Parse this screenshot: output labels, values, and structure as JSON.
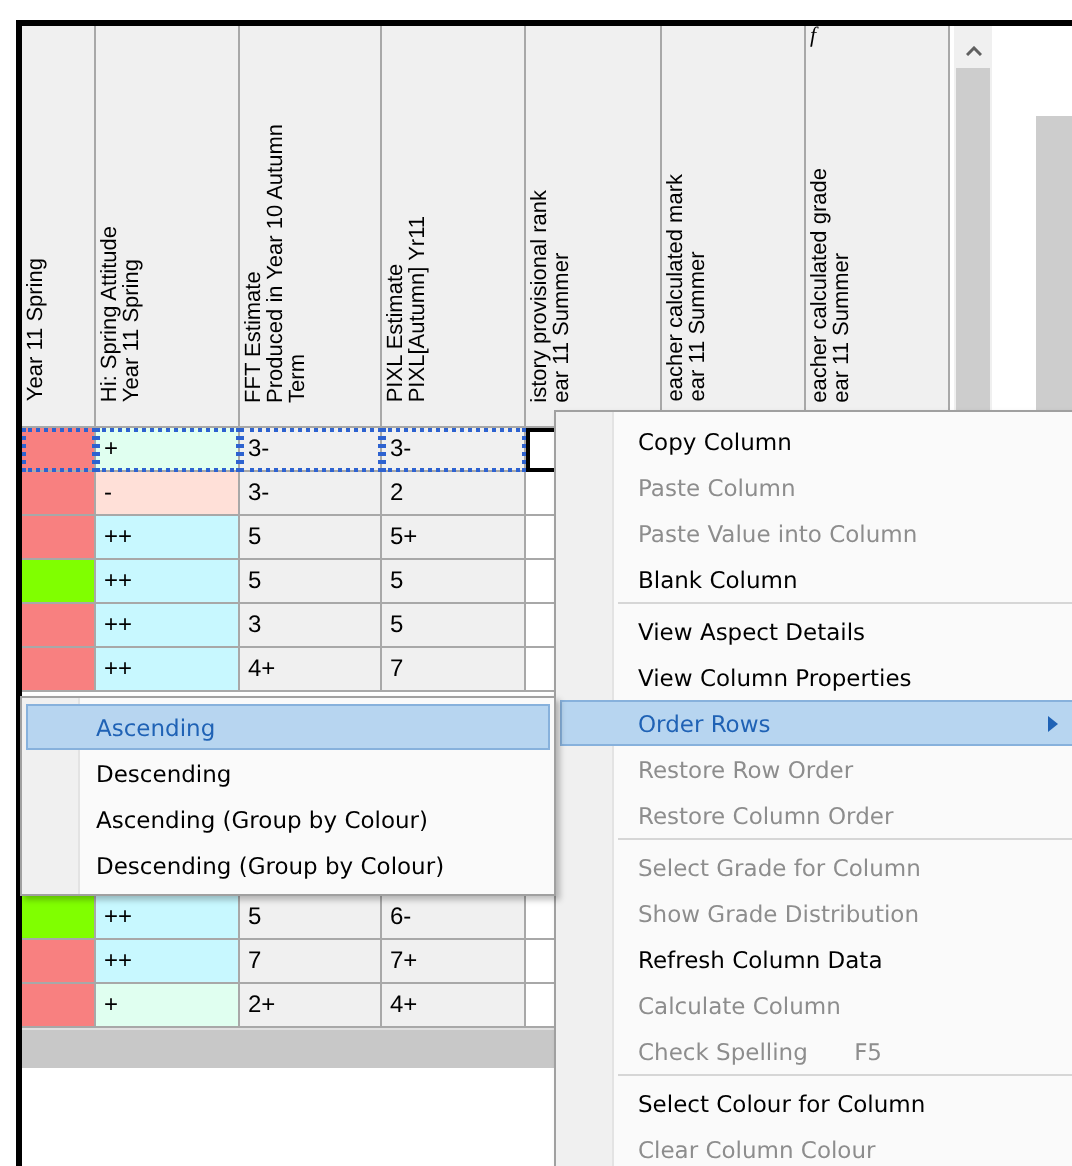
{
  "table": {
    "columns": [
      {
        "lines": [
          "Year 11 Spring"
        ]
      },
      {
        "lines": [
          "Hi: Spring Attitude",
          "Year 11 Spring"
        ]
      },
      {
        "lines": [
          "FFT Estimate",
          "Produced in Year 10 Autumn",
          "Term"
        ]
      },
      {
        "lines": [
          "PIXL Estimate",
          "PIXL[Autumn] Yr11"
        ]
      },
      {
        "lines": [
          "istory provisional rank",
          "ear 11 Summer"
        ]
      },
      {
        "lines": [
          "eacher calculated mark",
          "ear 11 Summer"
        ]
      },
      {
        "lines": [
          "eacher calculated grade",
          "ear 11 Summer"
        ],
        "formula_mark": "f"
      }
    ],
    "rows_above_menu": [
      {
        "selected": true,
        "band": {
          "color": "#f88080"
        },
        "attitude": {
          "text": "+",
          "color": "#e0fff0"
        },
        "fft": "3-",
        "pixl": "3-"
      },
      {
        "selected": false,
        "band": {
          "color": "#f88080"
        },
        "attitude": {
          "text": "-",
          "color": "#ffe0d8"
        },
        "fft": "3-",
        "pixl": "2"
      },
      {
        "selected": false,
        "band": {
          "color": "#f88080"
        },
        "attitude": {
          "text": "++",
          "color": "#c8f8ff"
        },
        "fft": "5",
        "pixl": "5+"
      },
      {
        "selected": false,
        "band": {
          "color": "#80ff00"
        },
        "attitude": {
          "text": "++",
          "color": "#c8f8ff"
        },
        "fft": "5",
        "pixl": "5"
      },
      {
        "selected": false,
        "band": {
          "color": "#f88080"
        },
        "attitude": {
          "text": "++",
          "color": "#c8f8ff"
        },
        "fft": "3",
        "pixl": "5"
      },
      {
        "selected": false,
        "band": {
          "color": "#f88080"
        },
        "attitude": {
          "text": "++",
          "color": "#c8f8ff"
        },
        "fft": "4+",
        "pixl": "7"
      }
    ],
    "rows_below_menu": [
      {
        "selected": false,
        "band": {
          "color": "#80ff00"
        },
        "attitude": {
          "text": "++",
          "color": "#c8f8ff"
        },
        "fft": "5",
        "pixl": "6-"
      },
      {
        "selected": false,
        "band": {
          "color": "#f88080"
        },
        "attitude": {
          "text": "++",
          "color": "#c8f8ff"
        },
        "fft": "7",
        "pixl": "7+"
      },
      {
        "selected": false,
        "band": {
          "color": "#f88080"
        },
        "attitude": {
          "text": "+",
          "color": "#e0fff0"
        },
        "fft": "2+",
        "pixl": "4+"
      }
    ]
  },
  "context_menu": {
    "items": [
      {
        "label": "Copy Column",
        "kind": "command",
        "disabled": false,
        "selected": false,
        "separator_after": false
      },
      {
        "label": "Paste Column",
        "kind": "command",
        "disabled": true,
        "selected": false,
        "separator_after": false
      },
      {
        "label": "Paste Value into Column",
        "kind": "command",
        "disabled": true,
        "selected": false,
        "separator_after": false
      },
      {
        "label": "Blank Column",
        "kind": "command",
        "disabled": false,
        "selected": false,
        "separator_after": true
      },
      {
        "label": "View Aspect Details",
        "kind": "command",
        "disabled": false,
        "selected": false,
        "separator_after": false
      },
      {
        "label": "View Column Properties",
        "kind": "command",
        "disabled": false,
        "selected": false,
        "separator_after": false
      },
      {
        "label": "Order Rows",
        "kind": "submenu",
        "disabled": false,
        "selected": true,
        "separator_after": false
      },
      {
        "label": "Restore Row Order",
        "kind": "command",
        "disabled": true,
        "selected": false,
        "separator_after": false
      },
      {
        "label": "Restore Column Order",
        "kind": "command",
        "disabled": true,
        "selected": false,
        "separator_after": true
      },
      {
        "label": "Select Grade for Column",
        "kind": "command",
        "disabled": true,
        "selected": false,
        "separator_after": false
      },
      {
        "label": "Show Grade Distribution",
        "kind": "command",
        "disabled": true,
        "selected": false,
        "separator_after": false
      },
      {
        "label": "Refresh Column Data",
        "kind": "command",
        "disabled": false,
        "selected": false,
        "separator_after": false
      },
      {
        "label": "Calculate Column",
        "kind": "command",
        "disabled": true,
        "selected": false,
        "separator_after": false
      },
      {
        "label": "Check Spelling",
        "shortcut": "F5",
        "kind": "command",
        "disabled": true,
        "selected": false,
        "separator_after": true
      },
      {
        "label": "Select Colour for Column",
        "kind": "command",
        "disabled": false,
        "selected": false,
        "separator_after": false
      },
      {
        "label": "Clear Column Colour",
        "kind": "command",
        "disabled": true,
        "selected": false,
        "separator_after": false
      }
    ]
  },
  "submenu": {
    "items": [
      {
        "label": "Ascending",
        "selected": true
      },
      {
        "label": "Descending",
        "selected": false
      },
      {
        "label": "Ascending (Group by Colour)",
        "selected": false
      },
      {
        "label": "Descending (Group by Colour)",
        "selected": false
      }
    ]
  }
}
